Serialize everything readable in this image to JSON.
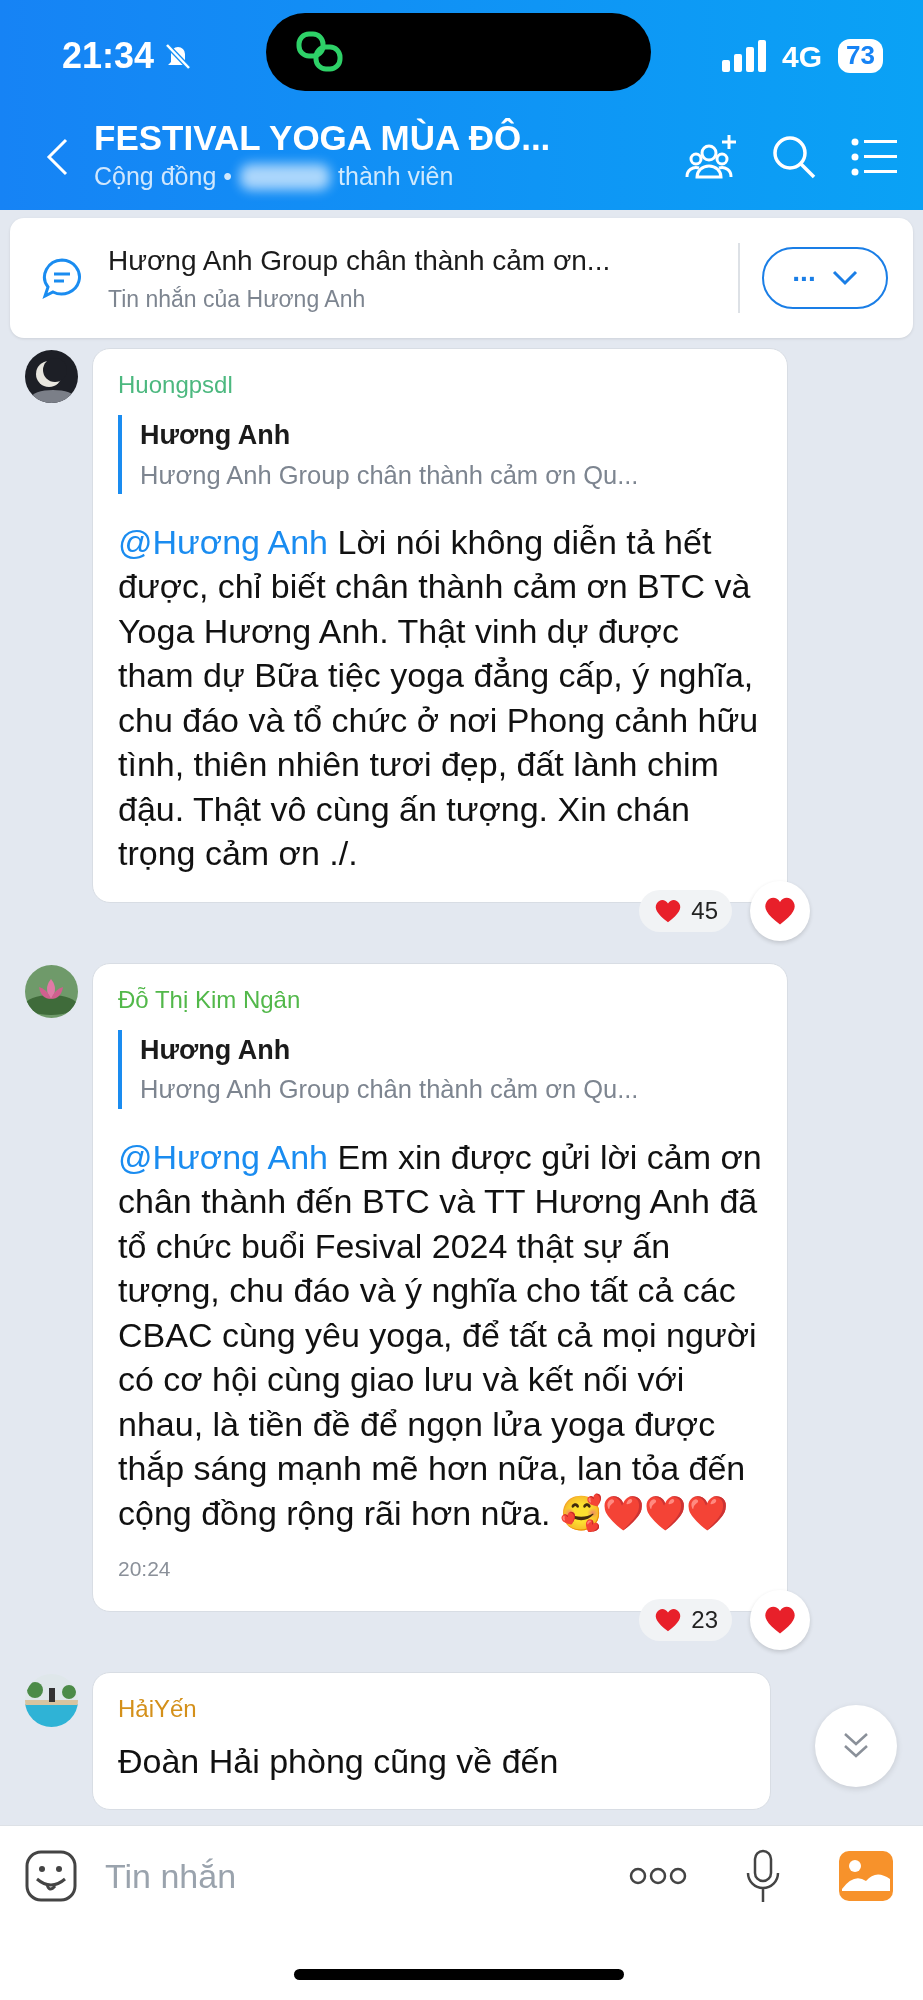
{
  "status_bar": {
    "time": "21:34",
    "network": "4G",
    "battery": "73"
  },
  "header": {
    "title": "FESTIVAL YOGA MÙA ĐÔ...",
    "subtitle_prefix": "Cộng đồng •",
    "subtitle_suffix": "thành viên"
  },
  "pinned_message": {
    "title": "Hương Anh Group chân thành cảm ơn...",
    "subtitle": "Tin nhắn của Hương Anh",
    "button_label": "..."
  },
  "messages": [
    {
      "sender": "Huongpsdl",
      "color": "#4cb87f",
      "quote": {
        "author": "Hương Anh",
        "text": "Hương Anh Group chân thành cảm ơn Qu..."
      },
      "mention": "@Hương Anh",
      "text": "Lời nói không diễn tả hết được, chỉ biết chân thành cảm ơn BTC và Yoga Hương Anh. Thật vinh dự được tham dự Bữa tiệc yoga đẳng cấp, ý nghĩa, chu đáo và tổ chức ở nơi Phong cảnh hữu tình, thiên nhiên tươi đẹp, đất lành chim đậu. Thật vô cùng ấn tượng. Xin chán trọng cảm ơn ./.",
      "reaction_count": "45"
    },
    {
      "sender": "Đỗ Thị Kim Ngân",
      "color": "#52b84a",
      "quote": {
        "author": "Hương Anh",
        "text": "Hương Anh Group chân thành cảm ơn Qu..."
      },
      "mention": "@Hương Anh",
      "text": "Em xin được gửi lời cảm ơn chân thành đến BTC và TT Hương Anh đã tổ chức buổi Fesival 2024 thật sự ấn tượng, chu đáo và ý nghĩa cho tất cả các CBAC cùng yêu yoga, để tất cả mọi người có cơ hội cùng giao lưu và kết nối với nhau, là tiền đề để ngọn lửa yoga được thắp sáng mạnh mẽ hơn nữa, lan tỏa đến cộng đồng rộng rãi hơn nữa. 🥰❤️❤️❤️",
      "time": "20:24",
      "reaction_count": "23"
    },
    {
      "sender": "HảiYến",
      "color": "#d4901a",
      "text": "Đoàn Hải phòng cũng về đến"
    }
  ],
  "composer": {
    "placeholder": "Tin nhắn"
  }
}
